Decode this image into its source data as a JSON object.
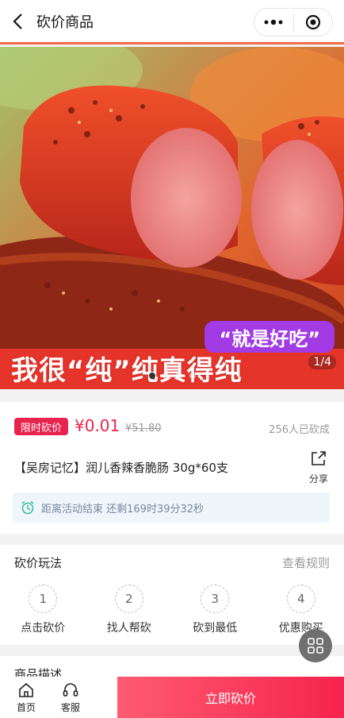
{
  "header": {
    "title": "砍价商品"
  },
  "hero": {
    "slogan": "“就是好吃”",
    "overlay_text": "我很“纯”纯真得纯",
    "counter": "1/4",
    "dots_total": 4,
    "dots_active": 0
  },
  "product": {
    "tag": "限时砍价",
    "price": "¥0.01",
    "original_price": "¥51.80",
    "sold": "256人已砍成",
    "name": "【吴房记忆】润儿香辣香脆肠 30g*60支",
    "share_label": "分享",
    "countdown": "距离活动结束 还剩169时39分32秒"
  },
  "rules_section": {
    "title": "砍价玩法",
    "link": "查看规则",
    "steps": [
      {
        "num": "1",
        "label": "点击砍价"
      },
      {
        "num": "2",
        "label": "找人帮砍"
      },
      {
        "num": "3",
        "label": "砍到最低"
      },
      {
        "num": "4",
        "label": "优惠购买"
      }
    ]
  },
  "description_section": {
    "title": "商品描述"
  },
  "bottom_bar": {
    "home_label": "首页",
    "service_label": "客服",
    "buy_label": "立即砍价"
  },
  "colors": {
    "accent": "#e8234e",
    "buy_gradient_start": "#ff5b72",
    "buy_gradient_end": "#f5234d"
  }
}
